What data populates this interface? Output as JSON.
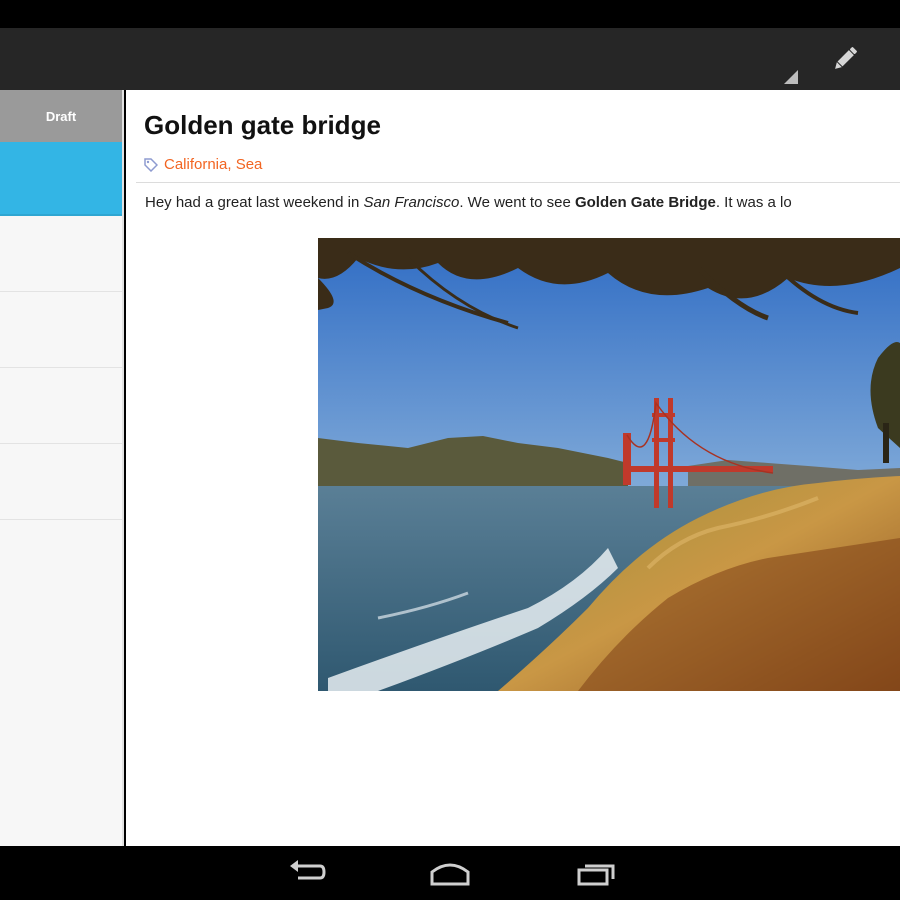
{
  "sidebar": {
    "header_label": "Draft",
    "items": [
      "",
      "",
      "",
      "",
      "",
      ""
    ]
  },
  "post": {
    "title": "Golden gate bridge",
    "tags": "California, Sea",
    "body": {
      "part1": "Hey had a great last weekend in ",
      "city": "San Francisco",
      "part2": ". We went to see ",
      "landmark": "Golden Gate Bridge",
      "part3": ". It was a lo"
    }
  },
  "colors": {
    "action_bar": "#262626",
    "accent_selected": "#33b5e5",
    "tag_color": "#f26522",
    "draft_header": "#9a9a9a"
  },
  "icons": {
    "edit": "pencil-icon",
    "tag": "tag-icon",
    "back": "back-icon",
    "home": "home-icon",
    "recents": "recent-apps-icon"
  }
}
